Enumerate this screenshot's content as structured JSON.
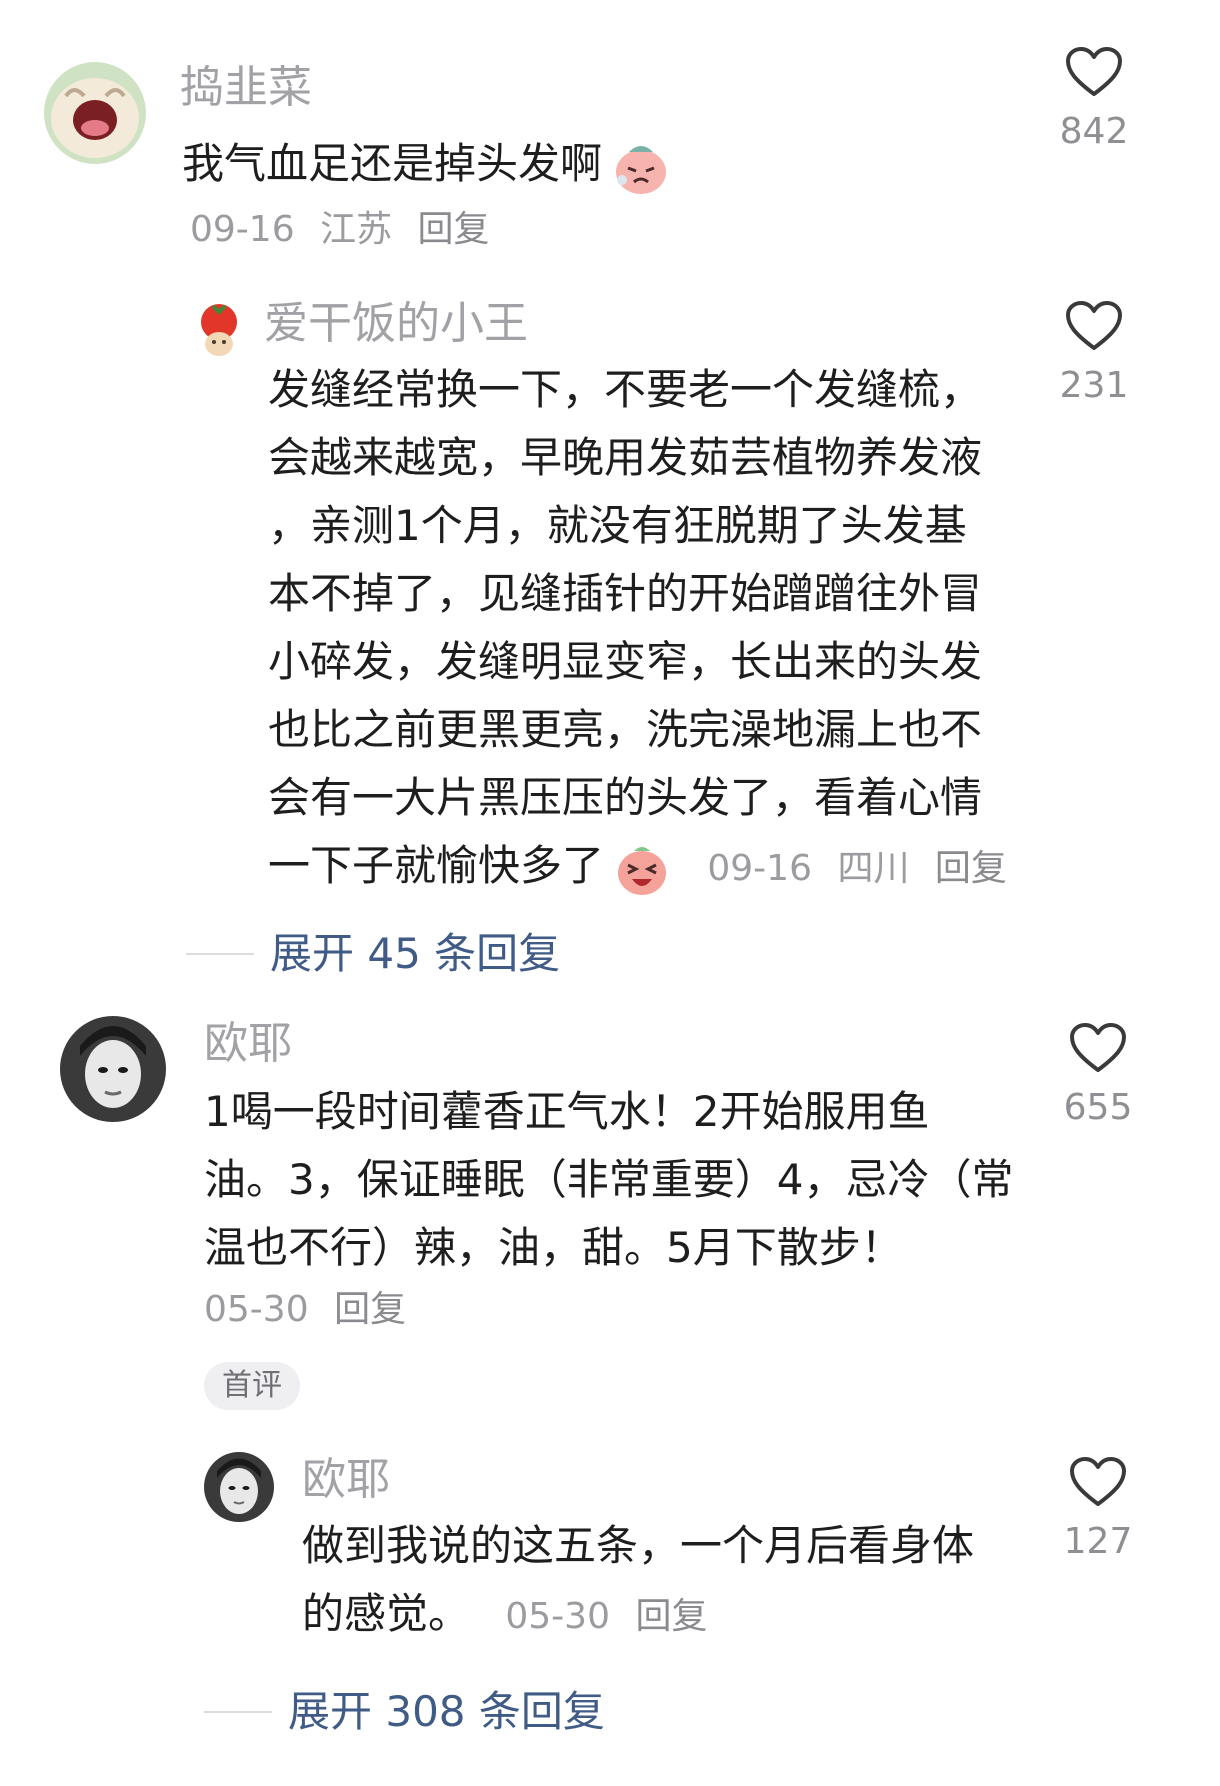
{
  "comments": [
    {
      "username": "捣韭菜",
      "text": "我气血足还是掉头发啊",
      "emoji_icon": "tired-face-emoji-icon",
      "date": "09-16",
      "location": "江苏",
      "reply_label": "回复",
      "likes": "842",
      "reply": {
        "username": "爱干饭的小王",
        "text_lines": [
          "发缝经常换一下，不要老一个发缝梳，",
          "会越来越宽，早晚用发茹芸植物养发液",
          "，亲测1个月，就没有狂脱期了头发基",
          "本不掉了，见缝插针的开始蹭蹭往外冒",
          "小碎发，发缝明显变窄，长出来的头发",
          "也比之前更黑更亮，洗完澡地漏上也不",
          "会有一大片黑压压的头发了，看着心情",
          "一下子就愉快多了"
        ],
        "emoji_icon": "laughing-face-emoji-icon",
        "date": "09-16",
        "location": "四川",
        "reply_label": "回复",
        "likes": "231"
      },
      "expand_label": "展开 45 条回复"
    },
    {
      "username": "欧耶",
      "text_lines": [
        "1喝一段时间藿香正气水！2开始服用鱼",
        "油。3，保证睡眠（非常重要）4，忌冷（常",
        "温也不行）辣，油，甜。5月下散步！"
      ],
      "date": "05-30",
      "reply_label": "回复",
      "badge": "首评",
      "likes": "655",
      "reply": {
        "username": "欧耶",
        "text_lines": [
          "做到我说的这五条，一个月后看身体",
          "的感觉。"
        ],
        "date": "05-30",
        "reply_label": "回复",
        "likes": "127"
      },
      "expand_label": "展开 308 条回复"
    }
  ],
  "colors": {
    "text": "#1e1e1e",
    "username": "#a1a1a6",
    "meta": "#9b9ba0",
    "expand_link": "#3f5b86",
    "badge_bg": "#efeff2"
  }
}
